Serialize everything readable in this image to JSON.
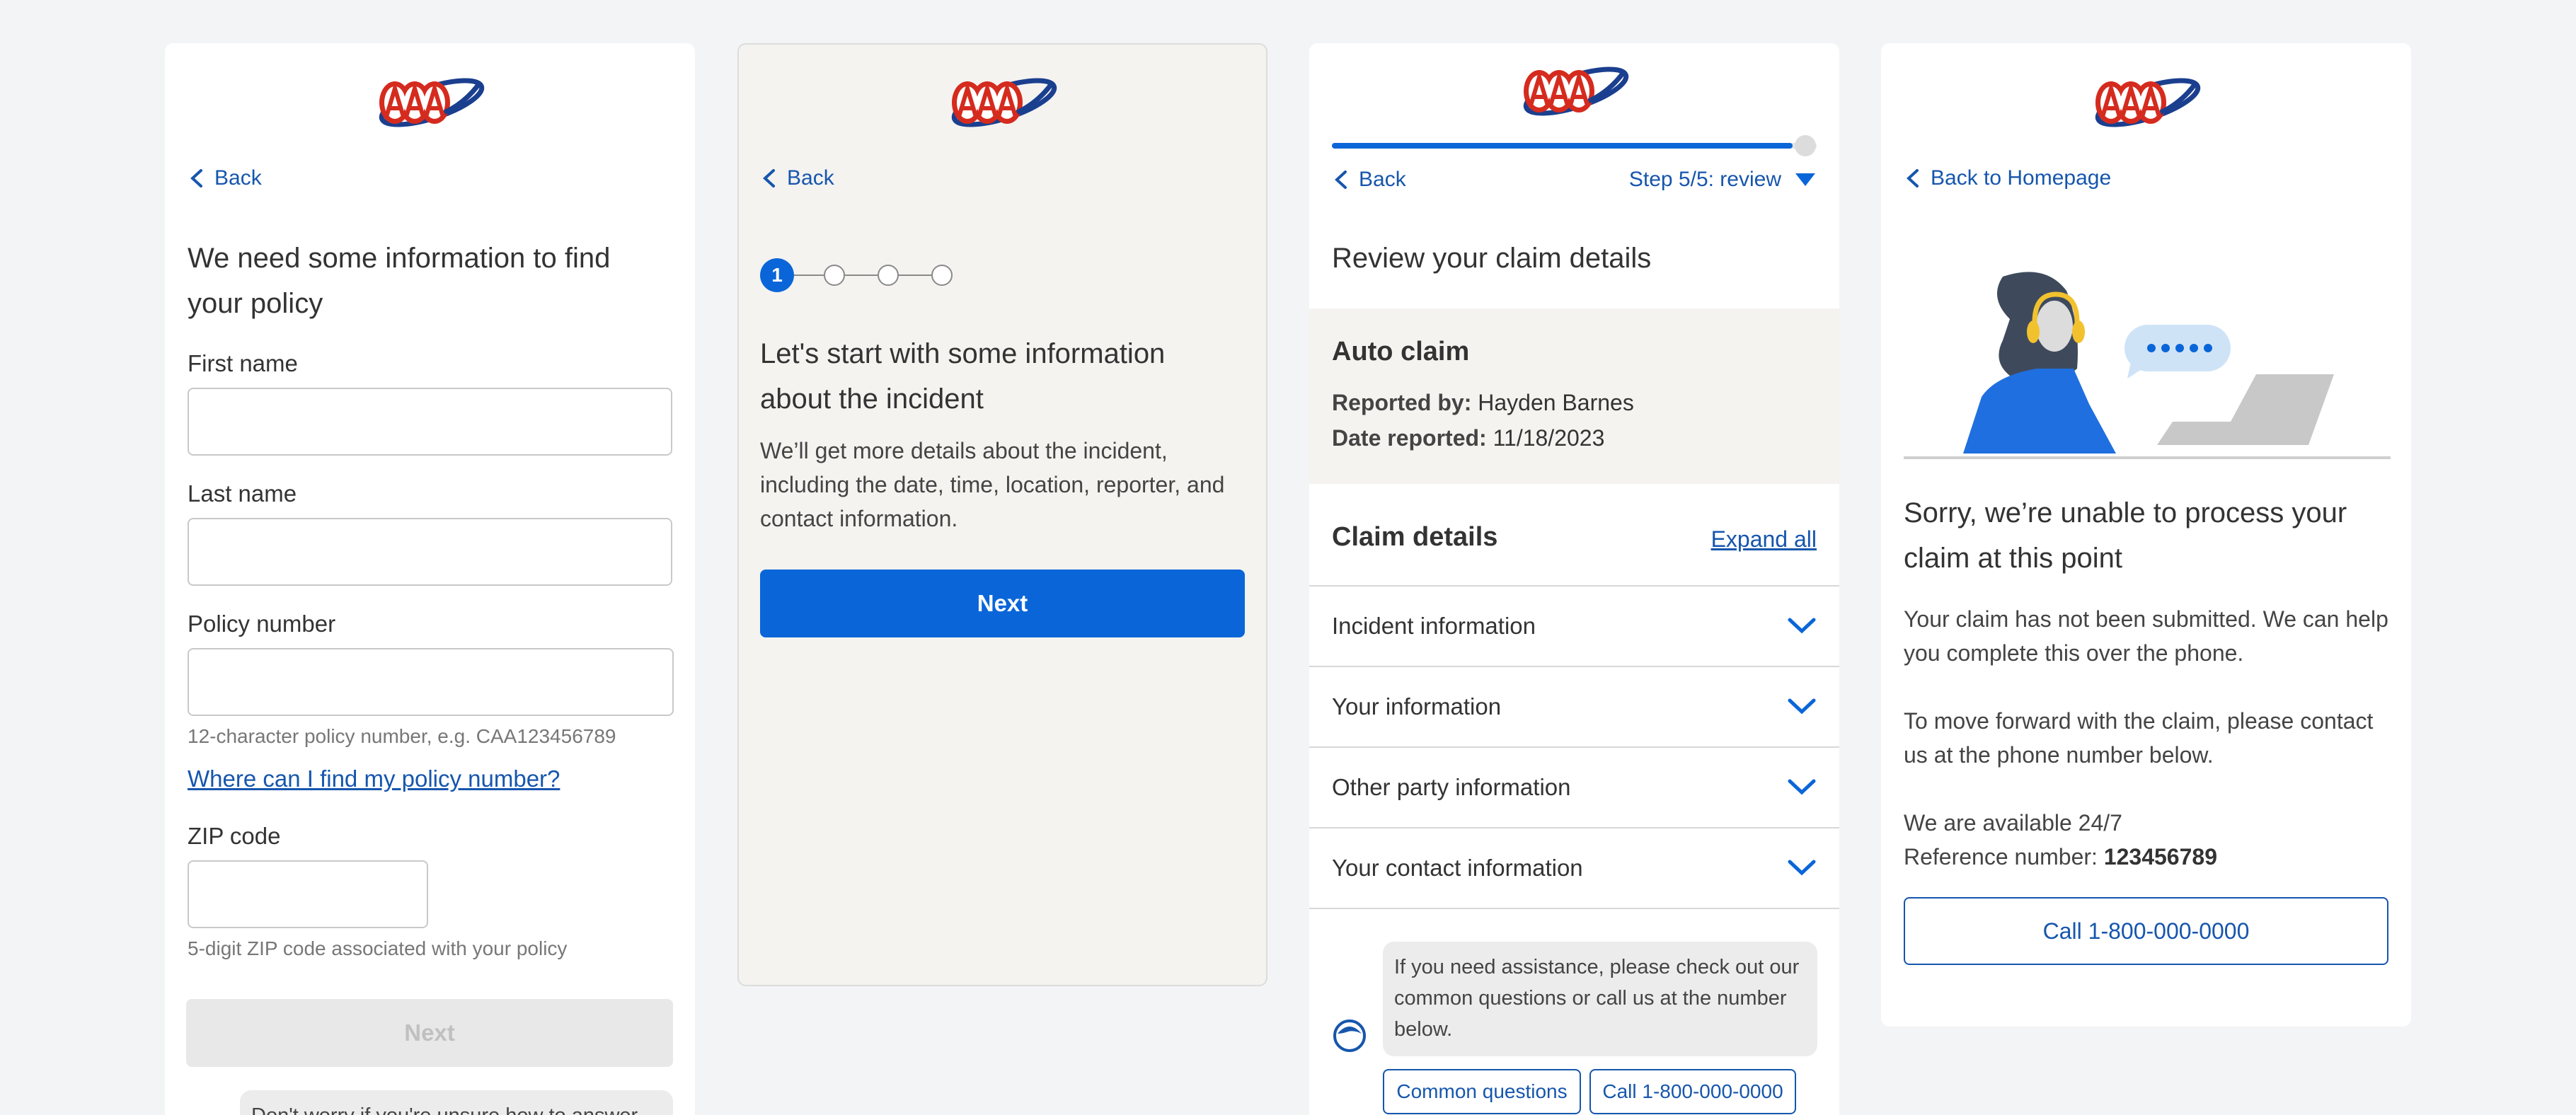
{
  "colors": {
    "accent": "#0a66d8",
    "link": "#1656ad",
    "brand_red": "#d52b1e",
    "brand_blue": "#1b3f8f"
  },
  "brand": {
    "logo_text": "AAA"
  },
  "panel1": {
    "back_label": "Back",
    "heading": "We need some information to find your policy",
    "first_name_label": "First name",
    "first_name_value": "",
    "last_name_label": "Last name",
    "last_name_value": "",
    "policy_label": "Policy number",
    "policy_value": "",
    "policy_hint": "12-character policy number, e.g. CAA123456789",
    "policy_help_link": "Where can I find my policy number?",
    "zip_label": "ZIP code",
    "zip_value": "",
    "zip_hint": "5-digit ZIP code associated with your policy",
    "next_label": "Next",
    "chat_text": "Don't worry if you're unsure how to answer..."
  },
  "panel2": {
    "back_label": "Back",
    "step_current": "1",
    "step_total": 4,
    "heading": "Let's start with some information about the incident",
    "body": "We’ll get more details about the incident, including the date, time, location, reporter, and contact information.",
    "next_label": "Next"
  },
  "panel3": {
    "progress": 0.95,
    "back_label": "Back",
    "step_label": "Step 5/5: review",
    "heading": "Review your claim details",
    "summary_title": "Auto claim",
    "reported_by_label": "Reported by:",
    "reported_by_value": "Hayden Barnes",
    "date_label": "Date reported:",
    "date_value": "11/18/2023",
    "details_title": "Claim details",
    "expand_all": "Expand all",
    "sections": [
      {
        "label": "Incident information"
      },
      {
        "label": "Your information"
      },
      {
        "label": "Other party information"
      },
      {
        "label": "Your contact information"
      }
    ],
    "chat_text": "If you need assistance, please check out our common questions or call us at the number below.",
    "common_questions": "Common questions",
    "call_label": "Call 1-800-000-0000"
  },
  "panel4": {
    "back_label": "Back to Homepage",
    "heading": "Sorry, we’re unable to process your claim at this point",
    "para1": "Your claim has not been submitted. We can help you complete this over the phone.",
    "para2": "To move forward with the claim, please contact us at the phone number below.",
    "availability": "We are available 24/7",
    "ref_label": "Reference number:",
    "ref_value": "123456789",
    "call_label": "Call 1-800-000-0000"
  }
}
